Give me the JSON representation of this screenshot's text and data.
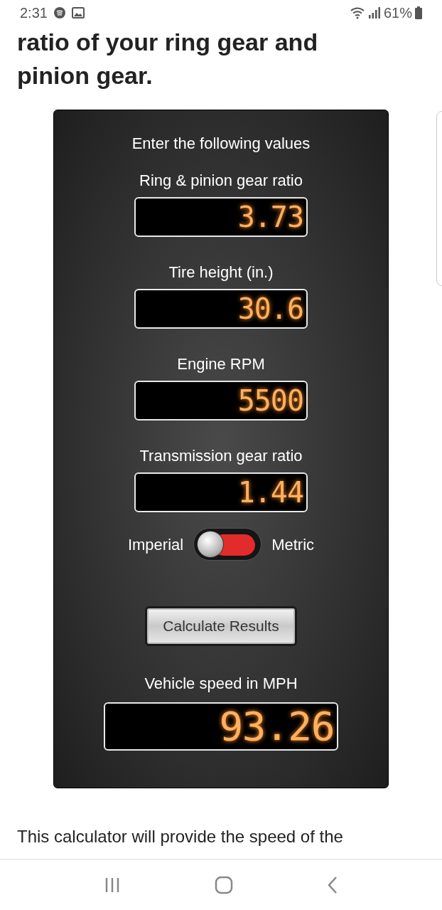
{
  "status_bar": {
    "time": "2:31",
    "battery": "61%"
  },
  "heading": "ratio of your ring gear and pinion gear.",
  "calculator": {
    "title": "Enter the following values",
    "fields": [
      {
        "label": "Ring & pinion gear ratio",
        "value": "3.73"
      },
      {
        "label": "Tire height (in.)",
        "value": "30.6"
      },
      {
        "label": "Engine RPM",
        "value": "5500"
      },
      {
        "label": "Transmission gear ratio",
        "value": "1.44"
      }
    ],
    "units": {
      "left": "Imperial",
      "right": "Metric",
      "on": false
    },
    "button": "Calculate Results",
    "result": {
      "label": "Vehicle speed in MPH",
      "value": "93.26"
    }
  },
  "paragraph": "This calculator will provide the speed of the"
}
